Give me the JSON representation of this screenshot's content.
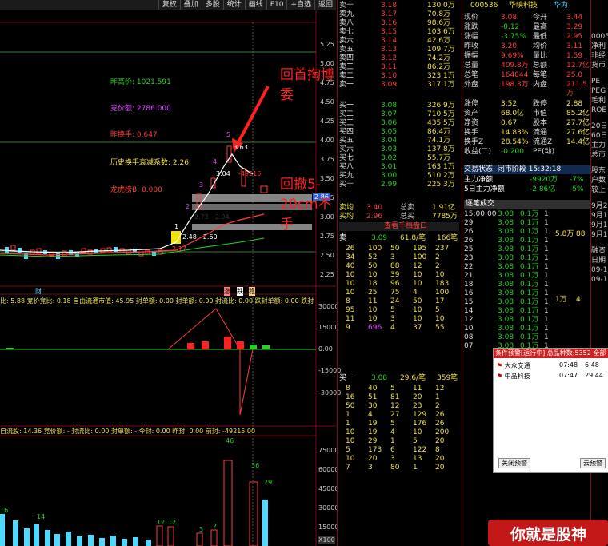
{
  "toolbar": {
    "items": [
      "复权",
      "叠加",
      "多股",
      "统计",
      "画线",
      "F10",
      "+自选",
      "返回"
    ]
  },
  "chart": {
    "price_ticks": [
      "5.25",
      "5.00",
      "4.75",
      "4.50",
      "4.25",
      "4.00",
      "3.75",
      "3.50",
      "3.25",
      "3.00",
      "2.75",
      "2.50",
      "2.25"
    ],
    "current_tag": "2.86",
    "labels": {
      "prev_high": "昨高价: 1021.591",
      "auction": "竞价额: 2786.000",
      "prev_turnover": "昨换手: 0.647",
      "hist_turnover": "历史换手衰减系数: 2.26",
      "dragon": "龙虎榜B: 0.000"
    },
    "annotations": {
      "top": "回首掏博委",
      "mid": "回撤5-20cm不手"
    },
    "price_marks": {
      "p5": "5",
      "p4": "4",
      "p3": "3",
      "p2": "2",
      "p1": "1",
      "high": "3.63",
      "mid1": "3.04",
      "mid2": "2.73 - 2.94",
      "mid3": "2.48 - 2.60",
      "low": "2.17",
      "neg": "-49215"
    },
    "markers": {
      "cai": "财",
      "zhang": "涨",
      "die": "跌",
      "wen": "稳"
    },
    "sub1_header": "比: 5.88  竞价竞比: 0.18  自由流通市值: 45.95  封单额: 0.00  封单额: 0.00  封流比: 0.00  跌封单额: 0.00  跌封流比: 0.00",
    "sub1_ticks": [
      "30000",
      "15000",
      "0.00",
      "-15000",
      "-30000"
    ],
    "sub2_header": "自流股: 14.36  竞价额: -  封流比: 0.00  封单额: -  今封: 0.00  昨封: 0.00  前封: -49215.00",
    "sub2_ticks": [
      "75000",
      "60000",
      "45000",
      "30000",
      "15000",
      "X100"
    ],
    "vol_labels": [
      "16",
      "14",
      "12",
      "12",
      "3",
      "2",
      "46",
      "36",
      "29"
    ]
  },
  "quote": {
    "asks": [
      {
        "label": "卖十",
        "price": "3.18",
        "vol": "130.0万"
      },
      {
        "label": "卖九",
        "price": "3.17",
        "vol": "70.8万"
      },
      {
        "label": "卖八",
        "price": "3.16",
        "vol": "98.6万"
      },
      {
        "label": "卖七",
        "price": "3.15",
        "vol": "103.6万"
      },
      {
        "label": "卖六",
        "price": "3.14",
        "vol": "42.6万"
      },
      {
        "label": "卖五",
        "price": "3.13",
        "vol": "109.7万"
      },
      {
        "label": "卖四",
        "price": "3.12",
        "vol": "74.2万"
      },
      {
        "label": "卖三",
        "price": "3.11",
        "vol": "86.2万"
      },
      {
        "label": "卖二",
        "price": "3.10",
        "vol": "323.1万"
      },
      {
        "label": "卖一",
        "price": "3.09",
        "vol": "317.1万"
      }
    ],
    "bids": [
      {
        "label": "买一",
        "price": "3.08",
        "vol": "326.9万"
      },
      {
        "label": "买二",
        "price": "3.07",
        "vol": "710.5万"
      },
      {
        "label": "买三",
        "price": "3.06",
        "vol": "435.5万"
      },
      {
        "label": "买四",
        "price": "3.05",
        "vol": "86.4万"
      },
      {
        "label": "买五",
        "price": "3.04",
        "vol": "74.1万"
      },
      {
        "label": "买六",
        "price": "3.03",
        "vol": "137.8万"
      },
      {
        "label": "买七",
        "price": "3.02",
        "vol": "55.7万"
      },
      {
        "label": "买八",
        "price": "3.01",
        "vol": "163.1万"
      },
      {
        "label": "买九",
        "price": "3.00",
        "vol": "510.2万"
      },
      {
        "label": "买十",
        "price": "2.99",
        "vol": "225.3万"
      }
    ],
    "avg_sell": {
      "label": "卖均",
      "price": "3.40",
      "k": "总卖",
      "v": "1.91亿"
    },
    "avg_buy": {
      "label": "买均",
      "price": "2.96",
      "k": "总买",
      "v": "7785万"
    },
    "view_more": "查看千档盘口",
    "sell1_header": {
      "label": "卖一",
      "price": "3.09",
      "per": "61.8/笔",
      "count": "166笔"
    },
    "sell1_rows": [
      [
        "26",
        "100",
        "50",
        "195",
        "237"
      ],
      [
        "34",
        "52",
        "3",
        "100",
        "2"
      ],
      [
        "40",
        "50",
        "88",
        "12",
        "2"
      ],
      [
        "10",
        "10",
        "39",
        "10",
        "10"
      ],
      [
        "10",
        "18",
        "96",
        "10",
        "183"
      ],
      [
        "10",
        "25",
        "75",
        "4",
        "100"
      ],
      [
        "8",
        "11",
        "24",
        "50",
        "17"
      ],
      [
        "95",
        "10",
        "5",
        "10",
        "5"
      ],
      [
        "11",
        "10",
        "3",
        "10",
        "10"
      ],
      [
        "9",
        "696",
        "4",
        "37",
        "55"
      ]
    ],
    "buy1_header": {
      "label": "买一",
      "price": "3.08",
      "per": "29.6/笔",
      "count": "359笔"
    },
    "buy1_rows": [
      [
        "8",
        "40",
        "5",
        "11",
        "12"
      ],
      [
        "16",
        "51",
        "81",
        "20",
        "1"
      ],
      [
        "50",
        "30",
        "12",
        "23",
        "2"
      ],
      [
        "1",
        "4",
        "27",
        "129",
        "26"
      ],
      [
        "1",
        "19",
        "5",
        "176",
        "26"
      ],
      [
        "10",
        "19",
        "4",
        "10",
        "200"
      ],
      [
        "10",
        "29",
        "1",
        "5",
        "20"
      ],
      [
        "5",
        "173",
        "6",
        "122",
        "8"
      ],
      [
        "10",
        "20",
        "3",
        "13",
        "20"
      ],
      [
        "7",
        "3",
        "80",
        "1",
        "20"
      ]
    ]
  },
  "info": {
    "code": "000536",
    "name": "华映科技",
    "tag": "华为",
    "stats": [
      {
        "k1": "现价",
        "v1": "3.08",
        "k2": "今开",
        "v2": "3.44"
      },
      {
        "k1": "涨跌",
        "v1": "-0.12",
        "k2": "最高",
        "v2": "3.29"
      },
      {
        "k1": "涨幅",
        "v1": "-3.75%",
        "k2": "最低",
        "v2": "2.95"
      },
      {
        "k1": "昨收",
        "v1": "3.20",
        "k2": "均价",
        "v2": "3.11"
      },
      {
        "k1": "振幅",
        "v1": "9.69%",
        "k2": "量比",
        "v2": "1.59"
      },
      {
        "k1": "总量",
        "v1": "409.8万",
        "k2": "总额",
        "v2": "12.7亿"
      },
      {
        "k1": "总笔",
        "v1": "164044",
        "k2": "每笔",
        "v2": "25.0"
      },
      {
        "k1": "外盘",
        "v1": "198.3万",
        "k2": "内盘",
        "v2": "211.5万"
      }
    ],
    "stats2": [
      {
        "k1": "涨停",
        "v1": "3.52",
        "k2": "跌停",
        "v2": "2.88"
      },
      {
        "k1": "资产",
        "v1": "68.0亿",
        "k2": "市值",
        "v2": "85.2亿"
      },
      {
        "k1": "净资",
        "v1": "0.67",
        "k2": "股本",
        "v2": "27.7亿"
      },
      {
        "k1": "换手",
        "v1": "14.83%",
        "k2": "流通",
        "v2": "27.6亿"
      },
      {
        "k1": "换手Z",
        "v1": "28.54%",
        "k2": "流通Z",
        "v2": "14.4亿"
      },
      {
        "k1": "收益(二)",
        "v1": "-0.200",
        "k2": "PE(动)",
        "v2": ""
      }
    ],
    "trade_state": "交易状态: 闭市阶段 15:32:18",
    "net1": {
      "k": "主力净额",
      "v": "-9920万",
      "p": "-7%"
    },
    "net5": {
      "k": "5日主力净额",
      "v": "-2.86亿",
      "p": "-5%"
    },
    "trades_header": "逐笔成交",
    "trades": [
      {
        "t": "15:00:00",
        "p": "3.08",
        "v": "0.1万",
        "n": "1"
      },
      {
        "t": "29",
        "p": "3.08",
        "v": "0.1万",
        "n": "1"
      },
      {
        "t": "26",
        "p": "3.08",
        "v": "0.1万",
        "n": "1"
      },
      {
        "t": "26",
        "p": "3.08",
        "v": "0.1万",
        "n": "1"
      },
      {
        "t": "25",
        "p": "3.08",
        "v": "0.1万",
        "n": "1"
      },
      {
        "t": "23",
        "p": "3.08",
        "v": "0.1万",
        "n": "1"
      },
      {
        "t": "22",
        "p": "3.08",
        "v": "0.1万",
        "n": "1"
      },
      {
        "t": "21",
        "p": "3.08",
        "v": "0.1万",
        "n": "1"
      },
      {
        "t": "18",
        "p": "3.08",
        "v": "0.1万",
        "n": "1"
      },
      {
        "t": "16",
        "p": "3.08",
        "v": "0.1万",
        "n": "1"
      },
      {
        "t": "15",
        "p": "3.08",
        "v": "0.1万",
        "n": "1"
      },
      {
        "t": "14",
        "p": "3.08",
        "v": "0.1万",
        "n": "1"
      },
      {
        "t": "12",
        "p": "3.08",
        "v": "0.1万",
        "n": "1"
      },
      {
        "t": "10",
        "p": "3.08",
        "v": "0.1万",
        "n": "1"
      },
      {
        "t": "08",
        "p": "3.08",
        "v": "0.1万",
        "n": "1"
      },
      {
        "t": "07",
        "p": "3.08",
        "v": "0.1万",
        "n": "1"
      },
      {
        "t": "06",
        "p": "3.08",
        "v": "0.1万",
        "n": "1"
      },
      {
        "t": "05",
        "p": "3.08",
        "v": "0.1万",
        "n": "1"
      },
      {
        "t": "03",
        "p": "3.08",
        "v": "0.1万",
        "n": "1"
      },
      {
        "t": "02",
        "p": "3.08",
        "v": "0.1万",
        "n": "1"
      },
      {
        "t": "01",
        "p": "3.08",
        "v": "0.1万",
        "n": "1"
      }
    ],
    "trade_sides": [
      {
        "v": "5.8万",
        "n": "88"
      },
      {
        "v": "1万",
        "n": "4"
      }
    ]
  },
  "alert": {
    "title": "条件预警[运行中] 总品种数:5352 全部",
    "items": [
      {
        "name": "大众交通",
        "time": "07:48",
        "val": "6.48"
      },
      {
        "name": "中晶科技",
        "time": "07:47",
        "val": "29.44"
      }
    ],
    "btn_close": "关闭预警",
    "btn_cloud": "云预警"
  },
  "farright": [
    "0005",
    "净利",
    "非经",
    "货币",
    "PE",
    "PEG",
    "毛利",
    "ROE",
    "20日",
    "60日",
    "主力",
    "总市",
    "股东",
    "户数",
    "较上",
    "9月2",
    "9月1",
    "9月1",
    "9月1",
    "融资",
    "日期",
    "09-1",
    "09-1"
  ],
  "watermark": "你就是股神"
}
